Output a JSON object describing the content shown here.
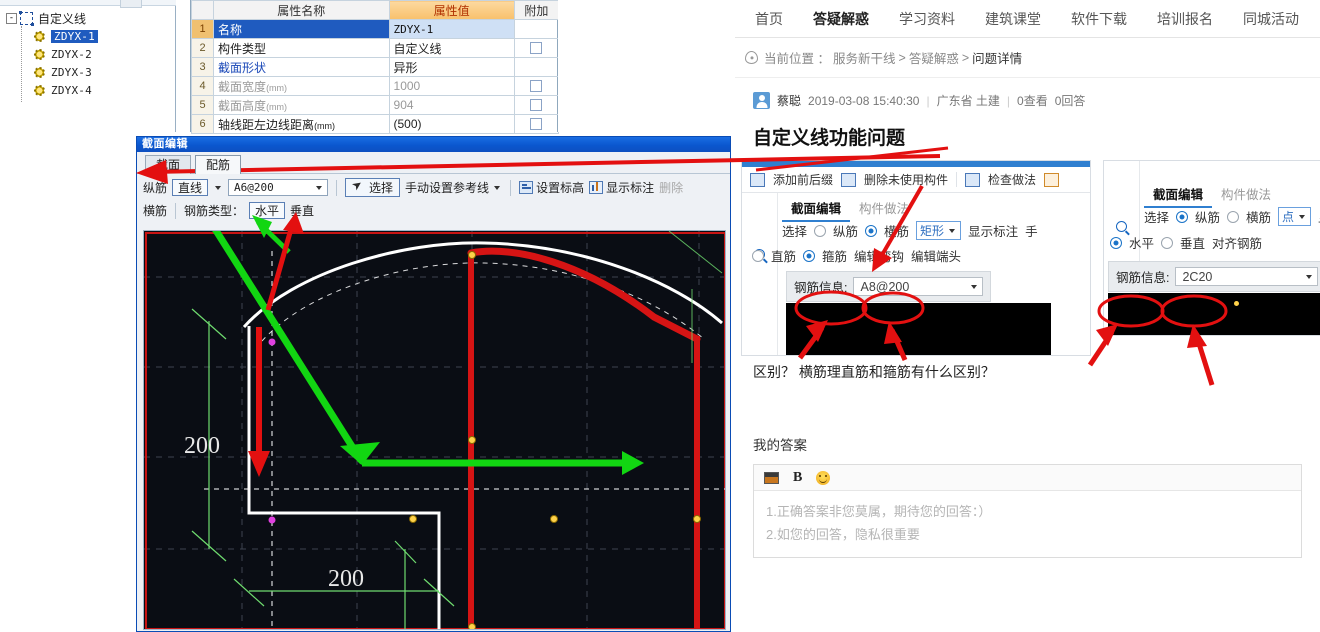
{
  "app": {
    "tree": {
      "root_label": "自定义线",
      "expander": "-",
      "items": [
        {
          "label": "ZDYX-1",
          "selected": true
        },
        {
          "label": "ZDYX-2",
          "selected": false
        },
        {
          "label": "ZDYX-3",
          "selected": false
        },
        {
          "label": "ZDYX-4",
          "selected": false
        }
      ]
    },
    "property_grid": {
      "headers": [
        "",
        "属性名称",
        "属性值",
        "附加"
      ],
      "rows": [
        {
          "idx": "1",
          "name": "名称",
          "value": "ZDYX-1",
          "attach": false,
          "selected": true,
          "dim": false,
          "link": false
        },
        {
          "idx": "2",
          "name": "构件类型",
          "value": "自定义线",
          "attach": true,
          "selected": false,
          "dim": false,
          "link": false
        },
        {
          "idx": "3",
          "name": "截面形状",
          "value": "异形",
          "attach": false,
          "selected": false,
          "dim": false,
          "link": true
        },
        {
          "idx": "4",
          "name": "截面宽度",
          "unit": "(mm)",
          "value": "1000",
          "attach": true,
          "selected": false,
          "dim": true,
          "link": false
        },
        {
          "idx": "5",
          "name": "截面高度",
          "unit": "(mm)",
          "value": "904",
          "attach": true,
          "selected": false,
          "dim": true,
          "link": false
        },
        {
          "idx": "6",
          "name": "轴线距左边线距离",
          "unit": "(mm)",
          "value": "(500)",
          "attach": true,
          "selected": false,
          "dim": false,
          "link": false
        }
      ]
    },
    "dialog": {
      "title": "截面编辑",
      "tabs": [
        {
          "label": "截面",
          "active": false
        },
        {
          "label": "配筋",
          "active": true
        }
      ],
      "toolbar_row1": {
        "label": "纵筋",
        "shape_button": "直线",
        "rebar_combo": "A6@200",
        "select_button": "选择",
        "ref_line": "手动设置参考线",
        "set_elevation": "设置标高",
        "show_annotation": "显示标注",
        "delete": "删除"
      },
      "toolbar_row2": {
        "label": "横筋",
        "type_label": "钢筋类型：",
        "horizontal": "水平",
        "vertical": "垂直"
      },
      "cad": {
        "dim_vertical": "200",
        "dim_horizontal": "200"
      }
    }
  },
  "web": {
    "nav": [
      {
        "label": "首页",
        "active": false
      },
      {
        "label": "答疑解惑",
        "active": true
      },
      {
        "label": "学习资料",
        "active": false
      },
      {
        "label": "建筑课堂",
        "active": false
      },
      {
        "label": "软件下载",
        "active": false
      },
      {
        "label": "培训报名",
        "active": false
      },
      {
        "label": "同城活动",
        "active": false
      }
    ],
    "breadcrumb": {
      "prefix": "当前位置 ：",
      "items": [
        "服务新干线",
        "答疑解惑"
      ],
      "separator": ">",
      "current": "问题详情"
    },
    "question": {
      "author": "蔡聪",
      "timestamp": "2019-03-08 15:40:30",
      "region": "广东省 土建",
      "views": "0查看",
      "answers": "0回答",
      "title": "自定义线功能问题",
      "body_text": "区别？ 横筋理直筋和箍筋有什么区别？"
    },
    "shot_left": {
      "toolbar": [
        {
          "label": "添加前后缀",
          "icon": "add-prefix-suffix-icon"
        },
        {
          "label": "删除未使用构件",
          "icon": "delete-unused-icon"
        },
        {
          "label": "检查做法",
          "icon": "check-method-icon"
        }
      ],
      "tabs": [
        {
          "label": "截面编辑",
          "active": true
        },
        {
          "label": "构件做法",
          "active": false
        }
      ],
      "row_select_label": "选择",
      "longitudinal": {
        "label": "纵筋",
        "checked": false
      },
      "transverse": {
        "label": "横筋",
        "checked": true
      },
      "shape_select": "矩形",
      "show_annotation": "显示标注",
      "manual_trunc": "手",
      "straight": {
        "label": "直筋",
        "checked": false
      },
      "stirrup": {
        "label": "箍筋",
        "checked": true
      },
      "edit_hook": "编辑弯钩",
      "edit_end": "编辑端头",
      "rebar_info_label": "钢筋信息:",
      "rebar_info_value": "A8@200"
    },
    "shot_right": {
      "tabs": [
        {
          "label": "截面编辑",
          "active": true
        },
        {
          "label": "构件做法",
          "active": false
        }
      ],
      "row_select_label": "选择",
      "longitudinal": {
        "label": "纵筋",
        "checked": true
      },
      "transverse": {
        "label": "横筋",
        "checked": false
      },
      "shape_select": "点",
      "show_annotation": "显",
      "horizontal": {
        "label": "水平",
        "checked": true
      },
      "vertical": {
        "label": "垂直",
        "checked": false
      },
      "align_rebar": "对齐钢筋",
      "rebar_info_label": "钢筋信息:",
      "rebar_info_value": "2C20"
    },
    "my_answer": {
      "heading": "我的答案",
      "tools": [
        "image-icon",
        "bold-icon",
        "emoji-icon"
      ],
      "bold_label": "B",
      "placeholder_line1": "1.正确答案非您莫属，期待您的回答：）",
      "placeholder_line2": "2.如您的回答，隐私很重要"
    }
  },
  "annotations": {
    "color_red": "#e31010",
    "color_green": "#12d612",
    "marks": [
      {
        "name": "arrow-to-peijin-tab",
        "color": "#e31010"
      },
      {
        "name": "arrow-to-shuiping-button",
        "color": "#12d612"
      },
      {
        "name": "arrow-to-chuizhi-button",
        "color": "#e31010"
      },
      {
        "name": "strikethrough-title",
        "color": "#e31010"
      },
      {
        "name": "arrow-to-hengjin-radio",
        "color": "#e31010"
      },
      {
        "name": "ellipse-zhijin",
        "color": "#e31010"
      },
      {
        "name": "ellipse-gujin",
        "color": "#e31010"
      },
      {
        "name": "ellipse-shuiping",
        "color": "#e31010"
      },
      {
        "name": "ellipse-chuizhi",
        "color": "#e31010"
      },
      {
        "name": "cad-green-polyline-arrow",
        "color": "#12d612"
      },
      {
        "name": "cad-red-down-arrow",
        "color": "#e31010"
      }
    ]
  }
}
